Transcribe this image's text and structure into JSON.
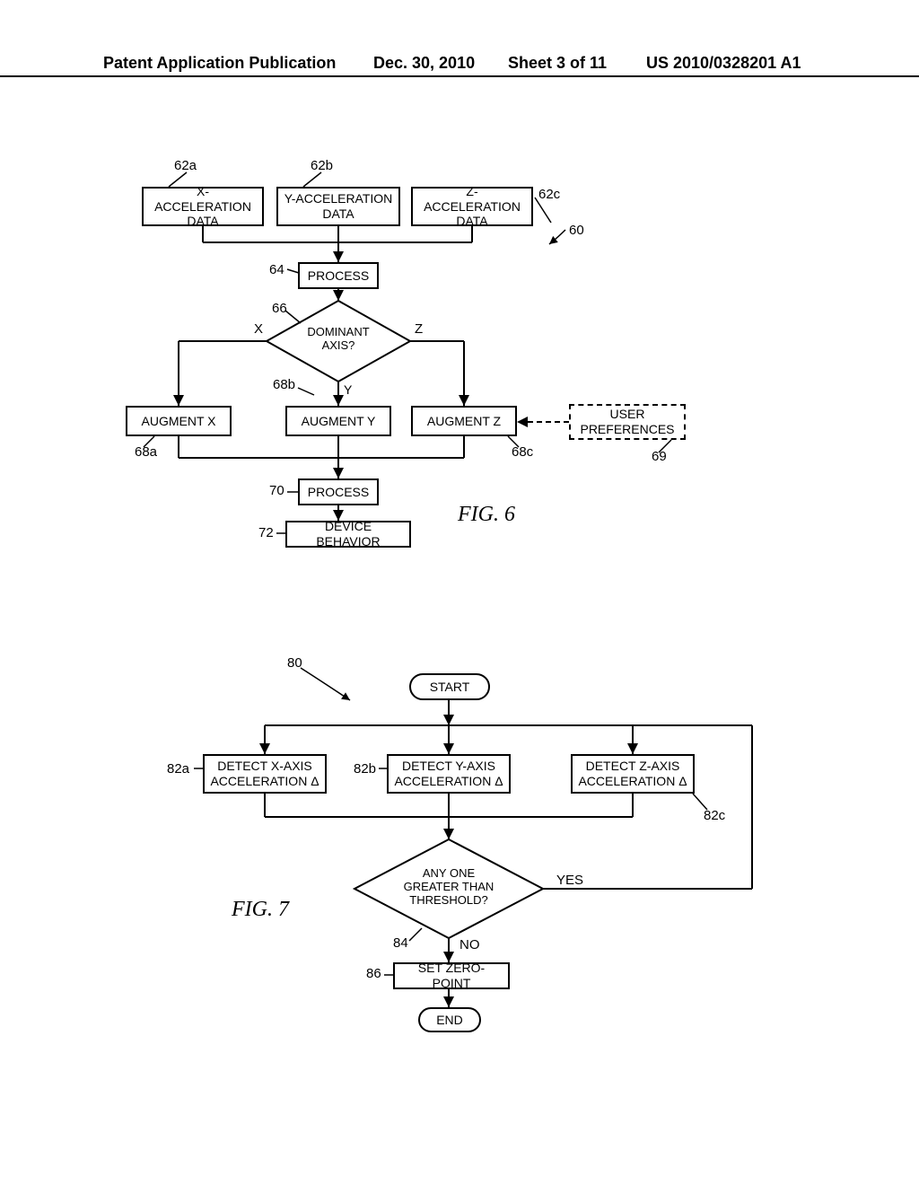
{
  "header": {
    "pub": "Patent Application Publication",
    "date": "Dec. 30, 2010",
    "sheet": "Sheet 3 of 11",
    "app": "US 2010/0328201 A1"
  },
  "fig6": {
    "ref_overall": "60",
    "xaccel": "X-ACCELERATION DATA",
    "yaccel": "Y-ACCELERATION DATA",
    "zaccel": "Z-ACCELERATION DATA",
    "ref62a": "62a",
    "ref62b": "62b",
    "ref62c": "62c",
    "process1": "PROCESS",
    "ref64": "64",
    "dominant": "DOMINANT AXIS?",
    "ref66": "66",
    "branchX": "X",
    "branchY": "Y",
    "branchZ": "Z",
    "augx": "AUGMENT X",
    "augy": "AUGMENT Y",
    "augz": "AUGMENT Z",
    "ref68a": "68a",
    "ref68b": "68b",
    "ref68c": "68c",
    "userpref": "USER PREFERENCES",
    "ref69": "69",
    "process2": "PROCESS",
    "ref70": "70",
    "devbehavior": "DEVICE BEHAVIOR",
    "ref72": "72",
    "caption": "FIG. 6"
  },
  "fig7": {
    "ref_overall": "80",
    "start": "START",
    "detx": "DETECT X-AXIS ACCELERATION Δ",
    "dety": "DETECT Y-AXIS ACCELERATION Δ",
    "detz": "DETECT Z-AXIS ACCELERATION Δ",
    "ref82a": "82a",
    "ref82b": "82b",
    "ref82c": "82c",
    "threshold": "ANY ONE GREATER THAN THRESHOLD?",
    "ref84": "84",
    "yes": "YES",
    "no": "NO",
    "zeropt": "SET ZERO-POINT",
    "ref86": "86",
    "end": "END",
    "caption": "FIG. 7"
  }
}
